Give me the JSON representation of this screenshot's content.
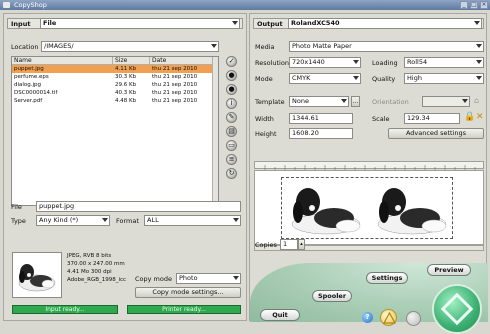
{
  "window": {
    "title": "CopyShop"
  },
  "input": {
    "section_label": "Input",
    "source_value": "File",
    "location_label": "Location",
    "location_value": "/IMAGES/",
    "columns": [
      "Name",
      "Size",
      "Date"
    ],
    "files": [
      {
        "name": "puppet.jpg",
        "size": "4.11 Kb",
        "date": "thu 21 sep 2010",
        "selected": true
      },
      {
        "name": "perfume.eps",
        "size": "30.3 Kb",
        "date": "thu 21 sep 2010",
        "selected": false
      },
      {
        "name": "dialog.jpg",
        "size": "29.6 Kb",
        "date": "thu 21 sep 2010",
        "selected": false
      },
      {
        "name": "DSC0000014.tif",
        "size": "40.3 Kb",
        "date": "thu 21 sep 2010",
        "selected": false
      },
      {
        "name": "Server.pdf",
        "size": "4.48 Kb",
        "date": "thu 21 sep 2010",
        "selected": false
      }
    ],
    "file_label": "File",
    "file_value": "puppet.jpg",
    "type_label": "Type",
    "type_value": "Any Kind (*)",
    "format_label": "Format",
    "format_value": "ALL",
    "image_info": [
      "JPEG, RVB 8 bits",
      "370.00 x 247.00 mm",
      "4.41 Mo 300 dpi",
      "Adobe_RGB_1998_icc"
    ],
    "copy_mode_label": "Copy mode",
    "copy_mode_value": "Photo",
    "copy_mode_settings_label": "Copy mode settings...",
    "input_status": "Input ready...",
    "printer_status": "Printer ready..."
  },
  "output": {
    "section_label": "Output",
    "printer_value": "RolandXC540",
    "media_label": "Media",
    "media_value": "Photo Matte Paper",
    "resolution_label": "Resolution",
    "resolution_value": "720x1440",
    "loading_label": "Loading",
    "loading_value": "Roll54",
    "mode_label": "Mode",
    "mode_value": "CMYK",
    "quality_label": "Quality",
    "quality_value": "High",
    "template_label": "Template",
    "template_value": "None",
    "orientation_label": "Orientation",
    "width_label": "Width",
    "width_value": "1344.61",
    "scale_label": "Scale",
    "scale_value": "129.34",
    "height_label": "Height",
    "height_value": "1608.20",
    "advanced_label": "Advanced settings",
    "copies_label": "Copies",
    "copies_value": "1"
  },
  "console": {
    "preview_label": "Preview",
    "settings_label": "Settings",
    "spooler_label": "Spooler",
    "quit_label": "Quit",
    "help_glyph": "?"
  },
  "colors": {
    "selection": "#f0a050",
    "status_green": "#2fa84f",
    "console_green": "#a9cdb5",
    "go_button": "#3caf72"
  }
}
